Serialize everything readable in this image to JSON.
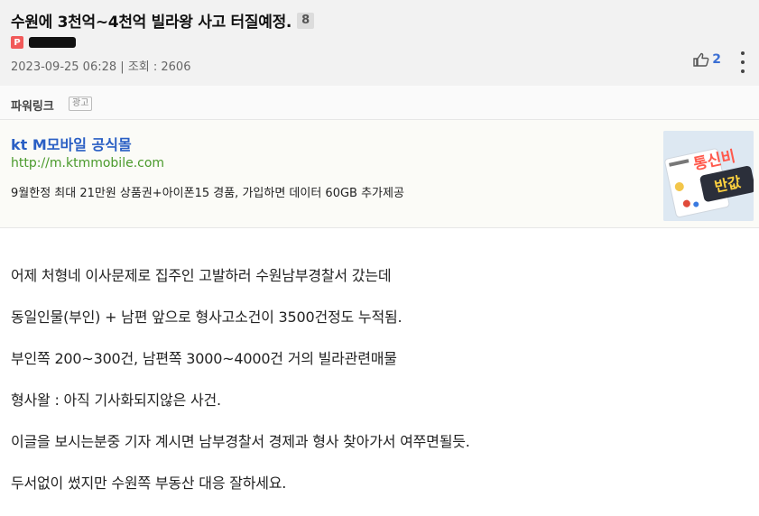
{
  "post": {
    "title": "수원에 3천억~4천억 빌라왕 사고 터질예정.",
    "comment_count": "8",
    "author_badge": "P",
    "date": "2023-09-25 06:28",
    "views_label": "조회 : 2606",
    "separator": "|",
    "likes": "2"
  },
  "powerlink": {
    "title": "파워링크",
    "ad_label": "광고",
    "ad_title": "kt M모바일 공식몰",
    "ad_url": "http://m.ktmmobile.com",
    "ad_desc": "9월한정 최대 21만원 상품권+아이폰15 경품, 가입하면 데이터 60GB 추가제공",
    "thumb_text_1": "통신비",
    "thumb_text_2": "반값"
  },
  "content": {
    "paragraphs": [
      "어제 처형네 이사문제로 집주인 고발하러 수원남부경찰서 갔는데",
      "동일인물(부인) + 남편 앞으로 형사고소건이 3500건정도 누적됨.",
      "부인쪽 200~300건, 남편쪽 3000~4000건 거의 빌라관련매물",
      "형사왈 : 아직 기사화되지않은 사건.",
      "이글을 보시는분중 기자 계시면 남부경찰서 경제과 형사 찾아가서 여쭈면될듯.",
      "두서없이 썼지만 수원쪽 부동산 대응 잘하세요."
    ]
  },
  "colors": {
    "accent_blue": "#2a5fc4",
    "url_green": "#4a9a2c",
    "badge_red": "#f15a5a",
    "like_blue": "#3b6fd4"
  },
  "icons": [
    "thumbs-up-icon",
    "more-vertical-icon",
    "p-badge-icon"
  ]
}
